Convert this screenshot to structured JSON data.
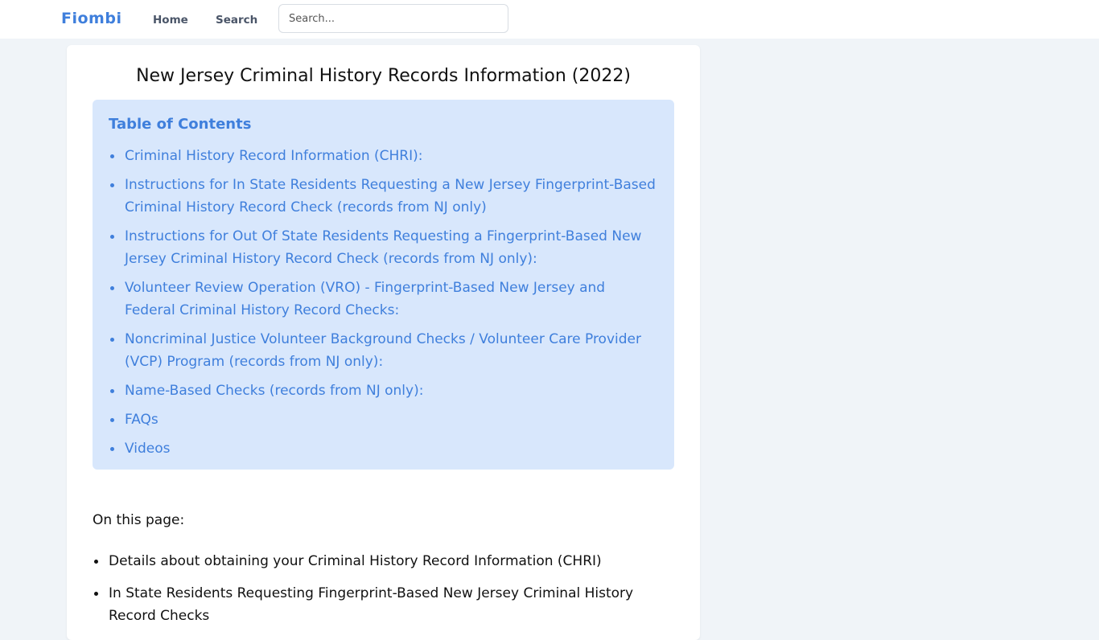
{
  "header": {
    "logo": "Fiombi",
    "nav": [
      "Home",
      "Search"
    ],
    "search_placeholder": "Search..."
  },
  "article": {
    "title": "New Jersey Criminal History Records Information (2022)",
    "toc": {
      "heading": "Table of Contents",
      "items": [
        "Criminal History Record Information (CHRI):",
        "Instructions for In State Residents Requesting a New Jersey Fingerprint-Based Criminal History Record Check (records from NJ only)",
        "Instructions for Out Of State Residents Requesting a Fingerprint-Based New Jersey Criminal History Record Check (records from NJ only):",
        "Volunteer Review Operation (VRO) - Fingerprint-Based New Jersey and Federal Criminal History Record Checks:",
        "Noncriminal Justice Volunteer Background Checks / Volunteer Care Provider (VCP) Program (records from NJ only):",
        "Name-Based Checks (records from NJ only):",
        "FAQs",
        "Videos"
      ]
    },
    "on_this_page_label": "On this page:",
    "on_this_page_items": [
      "Details about obtaining your Criminal History Record Information (CHRI)",
      "In State Residents Requesting Fingerprint-Based New Jersey Criminal History Record Checks"
    ]
  },
  "colors": {
    "accent": "#3f7fdc",
    "toc_background": "#d8e7fc",
    "page_background": "#f0f4f8"
  }
}
